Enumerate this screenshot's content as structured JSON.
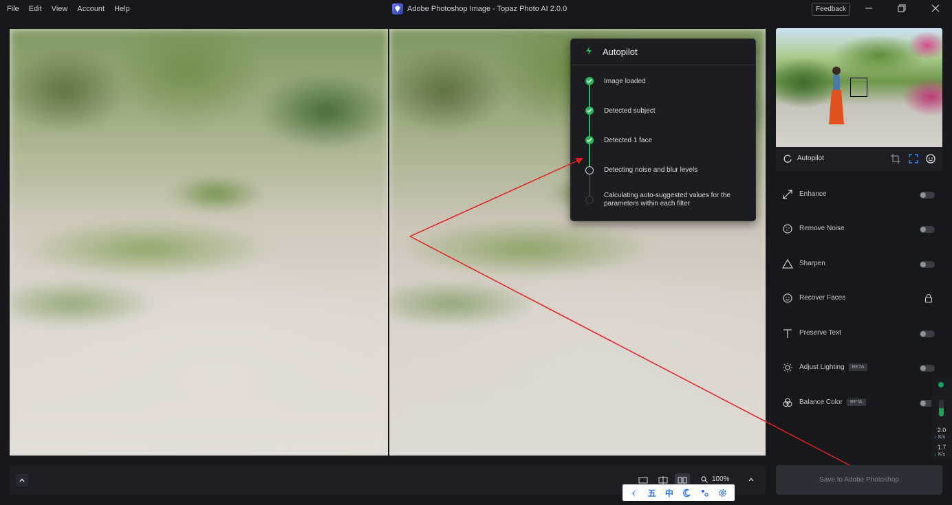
{
  "menu": [
    "File",
    "Edit",
    "View",
    "Account",
    "Help"
  ],
  "window": {
    "title": "Adobe Photoshop Image - Topaz Photo AI 2.0.0",
    "feedback_label": "Feedback"
  },
  "autopilot_popup": {
    "title": "Autopilot",
    "steps": [
      {
        "label": "Image loaded",
        "state": "done"
      },
      {
        "label": "Detected subject",
        "state": "done"
      },
      {
        "label": "Detected 1 face",
        "state": "done"
      },
      {
        "label": "Detecting noise and blur levels",
        "state": "active"
      },
      {
        "label": "Calculating auto-suggested values for the parameters within each filter",
        "state": "pending"
      }
    ]
  },
  "toolbar": {
    "zoom": "100%"
  },
  "thumbnail": {
    "autopilot_label": "Autopilot"
  },
  "filters": [
    {
      "name": "Enhance",
      "icon": "expand-arrows-icon",
      "control": "toggle",
      "enabled": false,
      "beta": ""
    },
    {
      "name": "Remove Noise",
      "icon": "noise-icon",
      "control": "toggle",
      "enabled": false,
      "beta": ""
    },
    {
      "name": "Sharpen",
      "icon": "triangle-icon",
      "control": "toggle",
      "enabled": false,
      "beta": ""
    },
    {
      "name": "Recover Faces",
      "icon": "face-icon",
      "control": "lock",
      "enabled": false,
      "beta": ""
    },
    {
      "name": "Preserve Text",
      "icon": "text-icon",
      "control": "toggle",
      "enabled": false,
      "beta": ""
    },
    {
      "name": "Adjust Lighting",
      "icon": "sun-icon",
      "control": "toggle",
      "enabled": false,
      "beta": "BETA"
    },
    {
      "name": "Balance Color",
      "icon": "color-circles-icon",
      "control": "toggle",
      "enabled": false,
      "beta": "BETA"
    }
  ],
  "save_button": "Save to Adobe Photoshop",
  "net_meter": {
    "upload": "2.0",
    "download": "1.7",
    "unit": "K/s",
    "level": 0.5
  },
  "ime": {
    "chars": [
      "五",
      "中"
    ]
  },
  "colors": {
    "accent_green": "#2bb45a",
    "annotation_red": "#e02020",
    "background": "#16181c"
  }
}
